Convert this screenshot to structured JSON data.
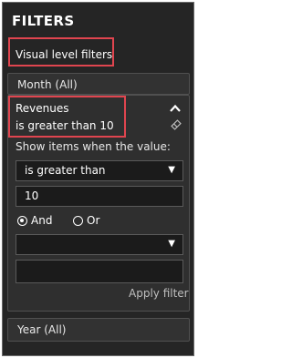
{
  "panel": {
    "title": "FILTERS",
    "section_label": "Visual level filters"
  },
  "filters": {
    "month": "Month  (All)",
    "revenues": {
      "name": "Revenues",
      "condition": "is greater than 10",
      "show_items_label": "Show items when the value:",
      "operator": "is greater than",
      "value": "10",
      "and_label": "And",
      "or_label": "Or",
      "second_operator": "",
      "second_value": "",
      "apply_label": "Apply filter"
    },
    "year": "Year  (All)"
  },
  "colors": {
    "panel_bg": "#252525",
    "highlight": "#e0454f"
  }
}
